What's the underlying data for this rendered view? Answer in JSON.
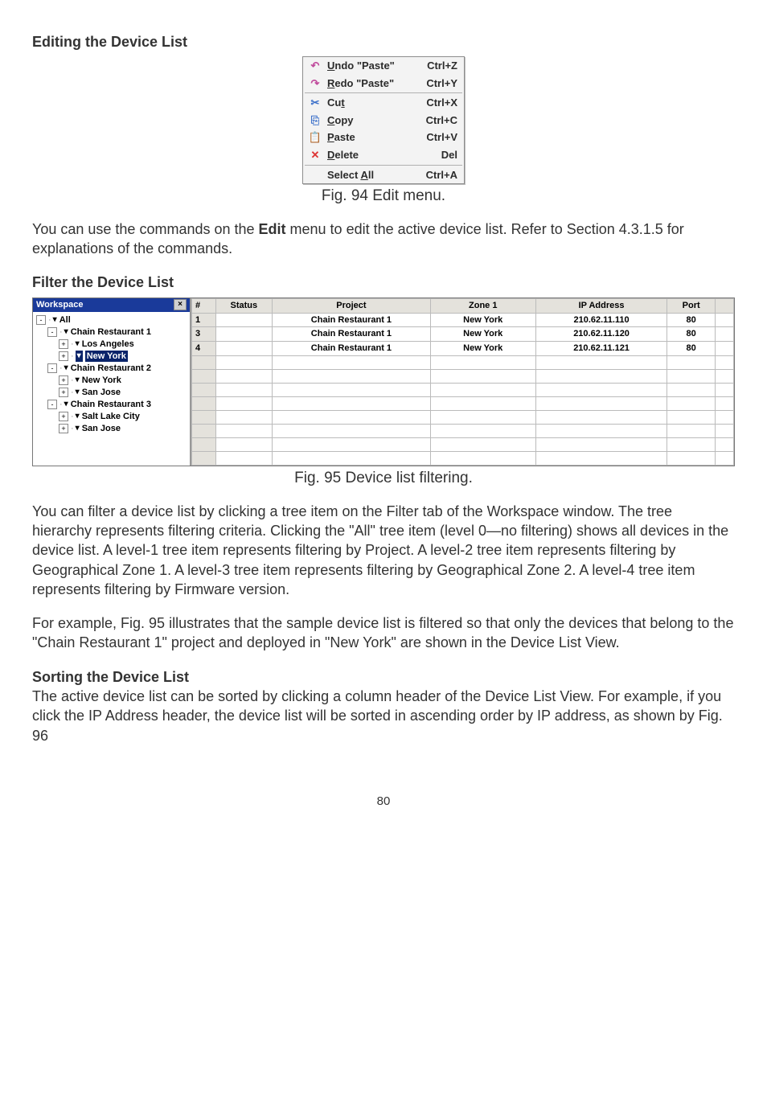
{
  "section1": {
    "title": "Editing the Device List"
  },
  "edit_menu": {
    "items": [
      {
        "label": "Undo \"Paste\"",
        "ul_char": "U",
        "rest": "ndo \"Paste\"",
        "shortcut": "Ctrl+Z",
        "icon_color": "#c04a9c"
      },
      {
        "label": "Redo \"Paste\"",
        "ul_char": "R",
        "rest": "edo \"Paste\"",
        "shortcut": "Ctrl+Y",
        "icon_color": "#c04a9c"
      },
      {
        "sep": true
      },
      {
        "label": "Cut",
        "pre": "Cu",
        "ul_char": "t",
        "rest": "",
        "shortcut": "Ctrl+X",
        "icon_color": "#3a6fc9"
      },
      {
        "label": "Copy",
        "ul_char": "C",
        "rest": "opy",
        "shortcut": "Ctrl+C",
        "icon_color": "#3a6fc9"
      },
      {
        "label": "Paste",
        "ul_char": "P",
        "rest": "aste",
        "shortcut": "Ctrl+V",
        "icon_color": "#c9a23a"
      },
      {
        "label": "Delete",
        "ul_char": "D",
        "rest": "elete",
        "shortcut": "Del",
        "icon_color": "#d33"
      },
      {
        "sep": true
      },
      {
        "label": "Select All",
        "pre": "Select ",
        "ul_char": "A",
        "rest": "ll",
        "shortcut": "Ctrl+A",
        "icon_color": ""
      }
    ],
    "caption": "Fig. 94 Edit menu."
  },
  "para1a": "You can use the commands on the ",
  "para1_bold": "Edit",
  "para1b": " menu to edit the active device list. Refer to Section 4.3.1.5 for explanations of the commands.",
  "section2": {
    "title": "Filter the Device List"
  },
  "workspace": {
    "title": "Workspace",
    "close": "×",
    "tree": [
      {
        "level": 1,
        "exp": "-",
        "label": "All"
      },
      {
        "level": 2,
        "exp": "-",
        "label": "Chain Restaurant 1"
      },
      {
        "level": 3,
        "exp": "+",
        "label": "Los Angeles"
      },
      {
        "level": 3,
        "exp": "+",
        "label": "New York",
        "selected": true
      },
      {
        "level": 2,
        "exp": "-",
        "label": "Chain Restaurant 2"
      },
      {
        "level": 3,
        "exp": "+",
        "label": "New York"
      },
      {
        "level": 3,
        "exp": "+",
        "label": "San Jose"
      },
      {
        "level": 2,
        "exp": "-",
        "label": "Chain Restaurant 3"
      },
      {
        "level": 3,
        "exp": "+",
        "label": "Salt Lake City"
      },
      {
        "level": 3,
        "exp": "+",
        "label": "San Jose"
      }
    ]
  },
  "device_table": {
    "headers": {
      "num": "#",
      "status": "Status",
      "project": "Project",
      "zone1": "Zone 1",
      "ip": "IP Address",
      "port": "Port"
    },
    "rows": [
      {
        "num": "1",
        "project": "Chain Restaurant 1",
        "zone1": "New York",
        "ip": "210.62.11.110",
        "port": "80"
      },
      {
        "num": "3",
        "project": "Chain Restaurant 1",
        "zone1": "New York",
        "ip": "210.62.11.120",
        "port": "80"
      },
      {
        "num": "4",
        "project": "Chain Restaurant 1",
        "zone1": "New York",
        "ip": "210.62.11.121",
        "port": "80"
      }
    ],
    "caption": "Fig. 95 Device list filtering."
  },
  "chart_data": {
    "type": "table",
    "title": "Device list filtering",
    "columns": [
      "#",
      "Status",
      "Project",
      "Zone 1",
      "IP Address",
      "Port"
    ],
    "rows": [
      [
        1,
        "",
        "Chain Restaurant 1",
        "New York",
        "210.62.11.110",
        80
      ],
      [
        3,
        "",
        "Chain Restaurant 1",
        "New York",
        "210.62.11.120",
        80
      ],
      [
        4,
        "",
        "Chain Restaurant 1",
        "New York",
        "210.62.11.121",
        80
      ]
    ]
  },
  "para2": "You can filter a device list by clicking a tree item on the Filter tab of the Workspace window. The tree hierarchy represents filtering criteria. Clicking the \"All\" tree item (level 0—no filtering) shows all devices in the device list. A level-1 tree item represents filtering by Project. A level-2 tree item represents filtering by Geographical Zone 1. A level-3 tree item represents filtering by Geographical Zone 2. A level-4 tree item represents filtering by Firmware version.",
  "para3": "For example, Fig. 95 illustrates that the sample device list is filtered so that only the devices that belong to the \"Chain Restaurant 1\" project and deployed in \"New York\" are shown in the Device List View.",
  "section3": {
    "title": "Sorting the Device List"
  },
  "para4": "The active device list can be sorted by clicking a column header of the Device List View. For example, if you click the IP Address header, the device list will be sorted in ascending order by IP address, as shown by Fig. 96",
  "page_number": "80"
}
